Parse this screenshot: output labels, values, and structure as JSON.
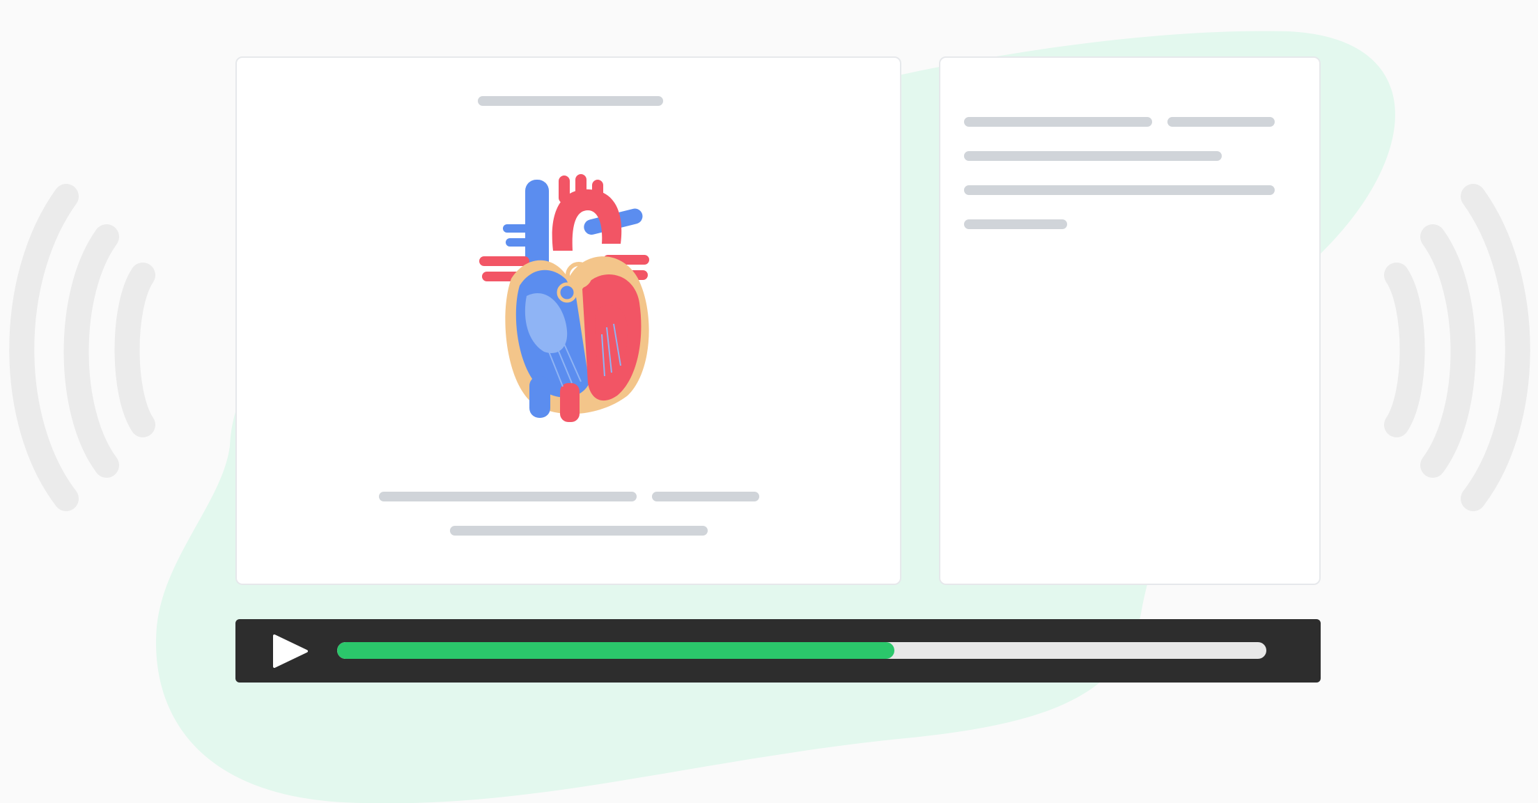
{
  "colors": {
    "background": "#fafafa",
    "blob": "#e3f8ee",
    "card": "#ffffff",
    "placeholder_line": "#d0d4d9",
    "sound_wave": "#ebebeb",
    "player_bg": "#2d2d2d",
    "progress_track": "#e8e8e8",
    "progress_fill": "#2bc76b",
    "play_icon": "#ffffff",
    "heart_red": "#f25565",
    "heart_blue": "#5b8def",
    "heart_light_blue": "#8fb4f5",
    "heart_wall": "#f3c58a"
  },
  "icons": {
    "play": "play-icon",
    "illustration": "heart-anatomy-illustration",
    "sound_left": "sound-wave-left-icon",
    "sound_right": "sound-wave-right-icon"
  },
  "player": {
    "progress_fraction": 0.6
  }
}
